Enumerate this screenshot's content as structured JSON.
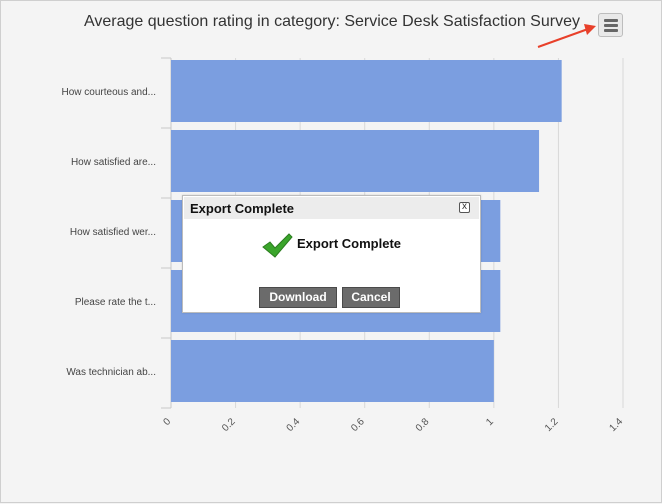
{
  "chart_data": {
    "type": "bar",
    "orientation": "horizontal",
    "title": "Average question rating in category: Service Desk Satisfaction Survey",
    "categories": [
      "How courteous and...",
      "How satisfied are...",
      "How satisfied wer...",
      "Please rate the t...",
      "Was technician ab..."
    ],
    "values": [
      1.21,
      1.14,
      1.02,
      1.02,
      1.0
    ],
    "x_ticks": [
      "0",
      "0.2",
      "0.4",
      "0.6",
      "0.8",
      "1",
      "1.2",
      "1.4"
    ],
    "xlim": [
      0,
      1.4
    ],
    "bar_color": "#7b9ee0",
    "grid": "vertical"
  },
  "menu": {
    "icon": "hamburger-menu-icon"
  },
  "annotation": {
    "arrow_color": "#e8402a"
  },
  "dialog": {
    "title": "Export Complete",
    "message": "Export Complete",
    "download_label": "Download",
    "cancel_label": "Cancel",
    "close_glyph": "x",
    "check_color": "#3aa52b"
  }
}
